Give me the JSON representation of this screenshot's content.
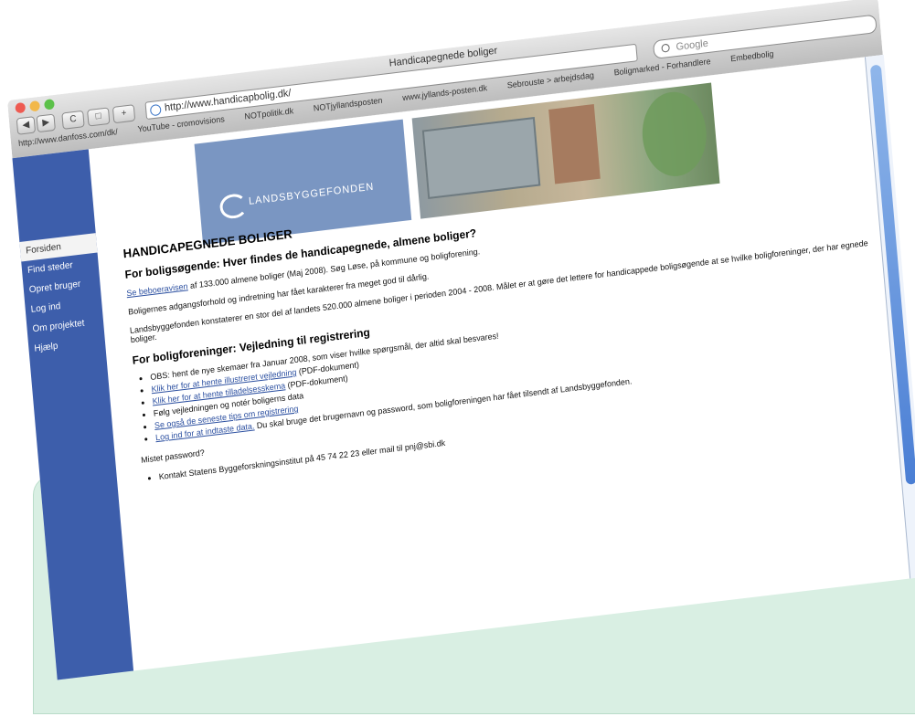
{
  "browser": {
    "window_title": "Handicapegnede boliger",
    "url": "http://www.handicapbolig.dk/",
    "search_placeholder": "Google",
    "back_button": "◀",
    "forward_button": "▶",
    "reload_button": "C",
    "tabs_button": "□",
    "add_bookmark_button": "+",
    "bookmarks": [
      "http://www.danfoss.com/dk/",
      "YouTube - cromovisions",
      "NOTpolitik.dk",
      "NOTjyllandsposten",
      "www.jyllands-posten.dk",
      "Sebrouste > arbejdsdag",
      "Boligmarked - Forhandlere",
      "Embedbolig"
    ]
  },
  "site": {
    "logo_text": "LANDSBYGGEFONDEN",
    "sidebar": [
      {
        "label": "Forsiden",
        "active": true
      },
      {
        "label": "Find steder",
        "active": false
      },
      {
        "label": "Opret bruger",
        "active": false
      },
      {
        "label": "Log ind",
        "active": false
      },
      {
        "label": "Om projektet",
        "active": false
      },
      {
        "label": "Hjælp",
        "active": false
      }
    ],
    "heading": "HANDICAPEGNEDE BOLIGER",
    "subheading1": "For boligsøgende: Hver findes de handicapegnede, almene boliger?",
    "p1_link": "Se beboeravisen",
    "p1_text": " af 133.000 almene boliger (Maj 2008). Søg Løse, på kommune og boligforening.",
    "p2": "Boligernes adgangsforhold og indretning har fået karakterer fra meget god til dårlig.",
    "p3": "Landsbyggefonden konstaterer en stor del af landets 520.000 almene boliger i perioden 2004 - 2008. Målet er at gøre det lettere for handicappede boligsøgende at se hvilke boligforeninger, der har egnede boliger.",
    "subheading2": "For boligforeninger: Vejledning til registrering",
    "list": [
      {
        "text": "OBS: hent de nye skemaer fra Januar 2008, som viser hvilke spørgsmål, der altid skal besvares!",
        "link": ""
      },
      {
        "text": "",
        "link": "Klik her for at hente illustreret vejledning",
        "suffix": " (PDF-dokument)"
      },
      {
        "text": "",
        "link": "Klik her for at hente tilladelsesskema",
        "suffix": " (PDF-dokument)"
      },
      {
        "text": "Følg vejledningen og notér boligerns data",
        "link": ""
      },
      {
        "text": "",
        "link": "Se også de seneste tips om registrering",
        "suffix": ""
      },
      {
        "text": "",
        "link": "Log ind for at indtaste data.",
        "suffix": " Du skal bruge det brugernavn og password, som boligforeningen har fået tilsendt af Landsbyggefonden."
      }
    ],
    "forgot_password": "Mistet password?",
    "contact": "Kontakt Statens Byggeforskningsinstitut på 45 74 22 23 eller mail til pnj@sbi.dk"
  }
}
